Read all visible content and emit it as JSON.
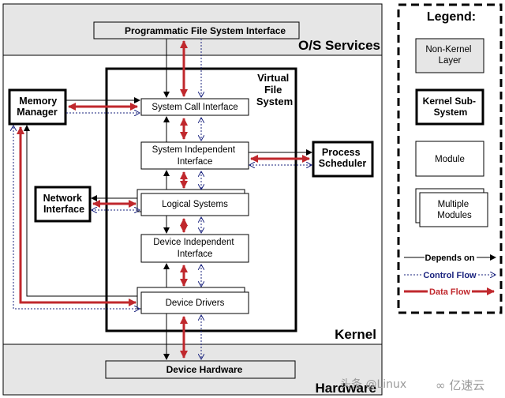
{
  "layers": {
    "os_services": "O/S Services",
    "kernel": "Kernel",
    "hardware": "Hardware"
  },
  "modules": {
    "programmatic_fs_interface": "Programmatic File System Interface",
    "vfs_title": [
      "Virtual",
      "File",
      "System"
    ],
    "system_call_interface": "System Call Interface",
    "system_independent_interface": [
      "System Independent",
      "Interface"
    ],
    "logical_systems": "Logical Systems",
    "device_independent_interface": [
      "Device Independent",
      "Interface"
    ],
    "device_drivers": "Device Drivers",
    "device_hardware": "Device Hardware",
    "memory_manager": [
      "Memory",
      "Manager"
    ],
    "network_interface": [
      "Network",
      "Interface"
    ],
    "process_scheduler": [
      "Process",
      "Scheduler"
    ]
  },
  "legend": {
    "title": "Legend:",
    "non_kernel_layer": [
      "Non-Kernel",
      "Layer"
    ],
    "kernel_subsystem": [
      "Kernel Sub-",
      "System"
    ],
    "module": "Module",
    "multiple_modules": [
      "Multiple",
      "Modules"
    ],
    "depends_on": "Depends on",
    "control_flow": "Control Flow",
    "data_flow": "Data Flow"
  },
  "colors": {
    "layer_fill": "#e6e6e6",
    "data_flow": "#c0282d",
    "control_flow": "#1a237e",
    "depends_on": "#000000"
  },
  "watermark": {
    "left": "头条 @Linux",
    "right": "亿速云"
  }
}
